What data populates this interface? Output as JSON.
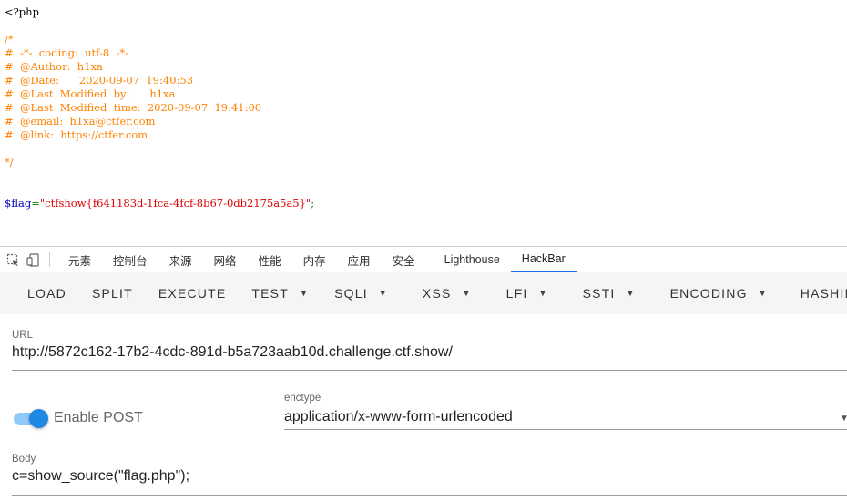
{
  "source": {
    "open_tag": "<?php",
    "comment_lines": [
      "/*",
      "#  -*-  coding:  utf-8  -*-",
      "#  @Author:  h1xa",
      "#  @Date:      2020-09-07  19:40:53",
      "#  @Last  Modified  by:      h1xa",
      "#  @Last  Modified  time:  2020-09-07  19:41:00",
      "#  @email:  h1xa@ctfer.com",
      "#  @link:  https://ctfer.com",
      "",
      "*/"
    ],
    "flag_var": "$flag",
    "flag_eq": "=",
    "flag_value": "\"ctfshow{f641183d-1fca-4fcf-8b67-0db2175a5a5}\"",
    "flag_semicolon": ";"
  },
  "devtools": {
    "tabs": [
      "元素",
      "控制台",
      "来源",
      "网络",
      "性能",
      "内存",
      "应用",
      "安全",
      "Lighthouse",
      "HackBar"
    ],
    "active_tab": "HackBar"
  },
  "hackbar": {
    "buttons": [
      {
        "label": "LOAD",
        "dropdown": false
      },
      {
        "label": "SPLIT",
        "dropdown": false
      },
      {
        "label": "EXECUTE",
        "dropdown": false
      },
      {
        "label": "TEST",
        "dropdown": true
      },
      {
        "label": "SQLI",
        "dropdown": true
      },
      {
        "label": "XSS",
        "dropdown": true
      },
      {
        "label": "LFI",
        "dropdown": true
      },
      {
        "label": "SSTI",
        "dropdown": true
      },
      {
        "label": "ENCODING",
        "dropdown": true
      },
      {
        "label": "HASHING",
        "dropdown": false
      }
    ],
    "url_label": "URL",
    "url_value": "http://5872c162-17b2-4cdc-891d-b5a723aab10d.challenge.ctf.show/",
    "enable_post_label": "Enable POST",
    "enable_post_on": true,
    "enctype_label": "enctype",
    "enctype_value": "application/x-www-form-urlencoded",
    "body_label": "Body",
    "body_value": "c=show_source(\"flag.php\");",
    "accent_color": "#1e88e5"
  }
}
